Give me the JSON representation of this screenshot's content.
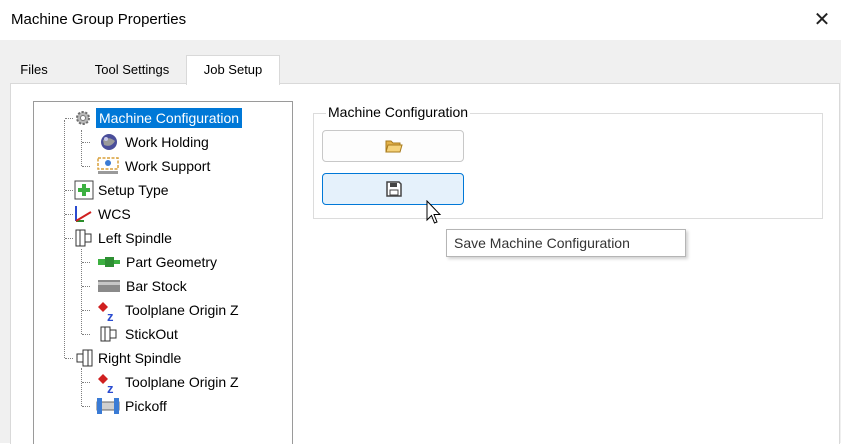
{
  "window": {
    "title": "Machine Group Properties",
    "close_glyph": "✕"
  },
  "tabs": [
    {
      "label": "Files",
      "active": false
    },
    {
      "label": "Tool Settings",
      "active": false
    },
    {
      "label": "Job Setup",
      "active": true
    }
  ],
  "tree": {
    "nodes": [
      {
        "label": "Machine Configuration",
        "icon": "gear-icon",
        "selected": true
      },
      {
        "label": "Work Holding",
        "icon": "sphere-icon"
      },
      {
        "label": "Work Support",
        "icon": "work-support-icon"
      },
      {
        "label": "Setup Type",
        "icon": "setup-type-icon"
      },
      {
        "label": "WCS",
        "icon": "axes-icon"
      },
      {
        "label": "Left Spindle",
        "icon": "spindle-icon"
      },
      {
        "label": "Part Geometry",
        "icon": "part-geometry-icon"
      },
      {
        "label": "Bar Stock",
        "icon": "bar-stock-icon"
      },
      {
        "label": "Toolplane Origin Z",
        "icon": "toolplane-origin-icon"
      },
      {
        "label": "StickOut",
        "icon": "stickout-icon"
      },
      {
        "label": "Right Spindle",
        "icon": "spindle-icon"
      },
      {
        "label": "Toolplane Origin Z",
        "icon": "toolplane-origin-icon"
      },
      {
        "label": "Pickoff",
        "icon": "pickoff-icon"
      }
    ]
  },
  "panel": {
    "group_title": "Machine Configuration",
    "open_icon": "folder-open-icon",
    "save_icon": "floppy-disk-icon"
  },
  "tooltip": {
    "text": "Save Machine Configuration"
  },
  "colors": {
    "selection": "#0078d7",
    "hover_fill": "#e5f1fb"
  }
}
